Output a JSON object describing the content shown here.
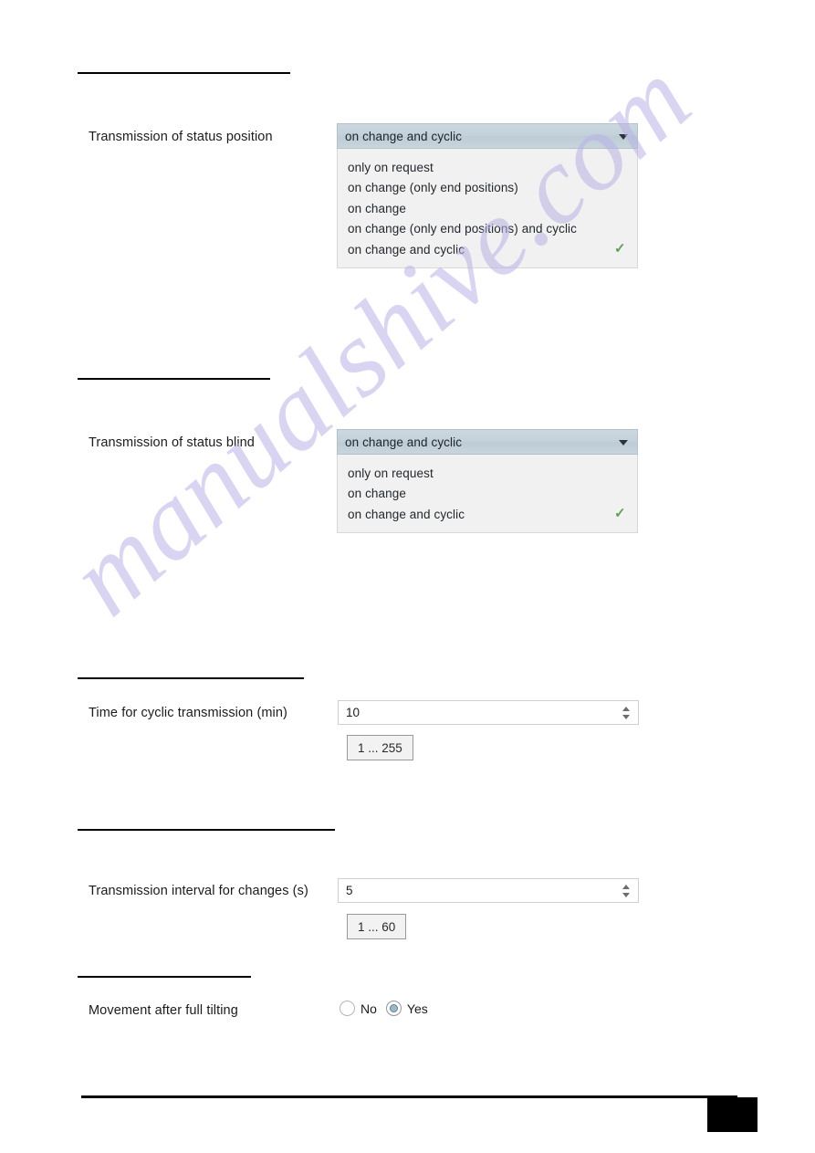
{
  "page": {
    "watermark": "manualshive.com"
  },
  "settings": [
    {
      "label": "Transmission of status position",
      "control": "dropdown",
      "value": "on change and cyclic",
      "options": [
        "only on request",
        "on change (only end positions)",
        "on change",
        "on change (only end positions) and cyclic",
        "on change and cyclic"
      ],
      "selected_index": 4,
      "check_icon": "check-icon",
      "arrow_icon": "chevron-down-icon"
    },
    {
      "label": "Transmission of status blind",
      "control": "dropdown",
      "value": "on change and cyclic",
      "options": [
        "only on request",
        "on change",
        "on change and cyclic"
      ],
      "selected_index": 2,
      "check_icon": "check-icon",
      "arrow_icon": "chevron-down-icon"
    },
    {
      "label": "Time for cyclic transmission (min)",
      "control": "spinner",
      "value": "10",
      "range_hint": "1 ... 255"
    },
    {
      "label": "Transmission interval for changes (s)",
      "control": "spinner",
      "value": "5",
      "range_hint": "1 ... 60"
    },
    {
      "label": "Movement after full tilting",
      "control": "radio",
      "options": [
        "No",
        "Yes"
      ],
      "selected": "Yes"
    }
  ],
  "colors": {
    "combo_header": "#c6d3dc",
    "combo_list": "#f1f1f1",
    "check_green": "#5aa254",
    "radio_fill": "#9fb7c9",
    "watermark": "#b9b2e6"
  }
}
